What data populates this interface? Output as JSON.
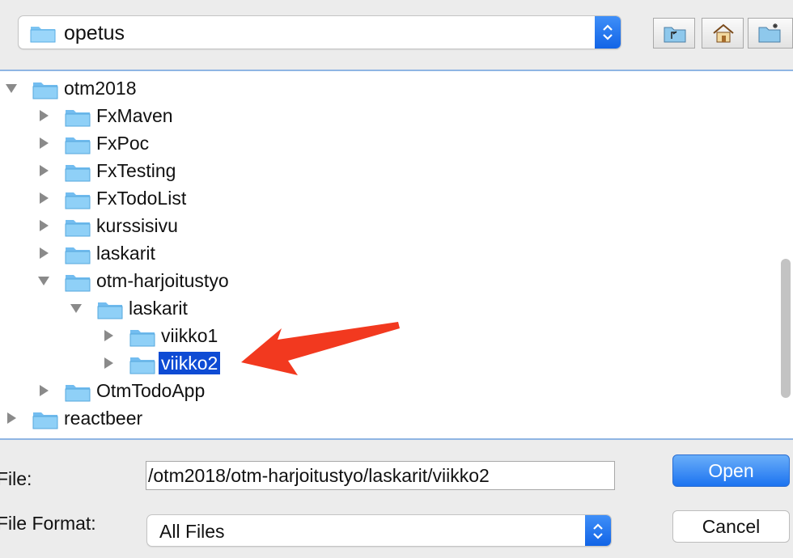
{
  "topbar": {
    "current_folder": "opetus",
    "tool_buttons": [
      {
        "name": "up-folder-icon"
      },
      {
        "name": "home-icon"
      },
      {
        "name": "new-folder-icon"
      }
    ]
  },
  "tree": [
    {
      "label": "otm2018",
      "depth": 0,
      "expanded": true,
      "selected": false
    },
    {
      "label": "FxMaven",
      "depth": 1,
      "expanded": false,
      "selected": false
    },
    {
      "label": "FxPoc",
      "depth": 1,
      "expanded": false,
      "selected": false
    },
    {
      "label": "FxTesting",
      "depth": 1,
      "expanded": false,
      "selected": false
    },
    {
      "label": "FxTodoList",
      "depth": 1,
      "expanded": false,
      "selected": false
    },
    {
      "label": "kurssisivu",
      "depth": 1,
      "expanded": false,
      "selected": false
    },
    {
      "label": "laskarit",
      "depth": 1,
      "expanded": false,
      "selected": false
    },
    {
      "label": "otm-harjoitustyo",
      "depth": 1,
      "expanded": true,
      "selected": false
    },
    {
      "label": "laskarit",
      "depth": 2,
      "expanded": true,
      "selected": false
    },
    {
      "label": "viikko1",
      "depth": 3,
      "expanded": false,
      "selected": false
    },
    {
      "label": "viikko2",
      "depth": 3,
      "expanded": false,
      "selected": true
    },
    {
      "label": "OtmTodoApp",
      "depth": 1,
      "expanded": false,
      "selected": false
    },
    {
      "label": "reactbeer",
      "depth": 0,
      "expanded": false,
      "selected": false
    }
  ],
  "bottom": {
    "file_label": "File:",
    "file_value": "/otm2018/otm-harjoitustyo/laskarit/viikko2",
    "format_label": "File Format:",
    "format_value": "All Files",
    "open_label": "Open",
    "cancel_label": "Cancel"
  },
  "colors": {
    "selection": "#0e4bd4",
    "accent": "#1c73f0",
    "annotation_arrow": "#f2391f",
    "folder": "#8fd0f7"
  }
}
